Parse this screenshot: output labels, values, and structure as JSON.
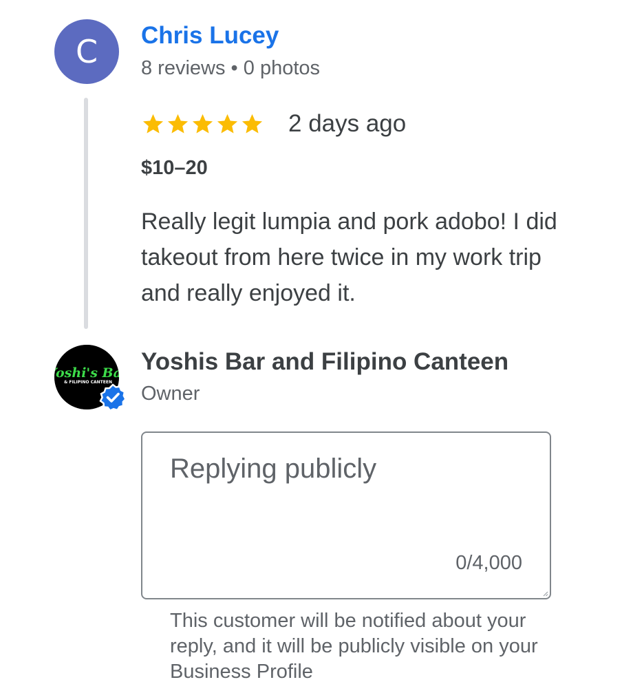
{
  "review": {
    "avatar_letter": "C",
    "avatar_color": "#5c6bc0",
    "reviewer_name": "Chris Lucey",
    "reviewer_stats": "8 reviews • 0 photos",
    "rating": 5,
    "rating_max": 5,
    "star_color": "#fbbc04",
    "date": "2 days ago",
    "price_range": "$10–20",
    "text": "Really legit lumpia and pork adobo! I did takeout from here twice in my work trip and really enjoyed it."
  },
  "owner": {
    "name": "Yoshis Bar and Filipino Canteen",
    "role": "Owner",
    "logo_text_main": "Yoshi's Bar",
    "logo_text_sub": "& FILIPINO CANTEEN",
    "logo_color": "#3ddc4a",
    "badge_icon": "verified-check-icon",
    "badge_color": "#1a73e8"
  },
  "reply": {
    "placeholder": "Replying publicly",
    "value": "",
    "counter": "0/4,000",
    "notice": "This customer will be notified about your reply, and it will be publicly visible on your Business Profile"
  },
  "colors": {
    "name_link": "#1a73e8",
    "primary_text": "#3c4043",
    "secondary_text": "#5f6368",
    "thread_line": "#dadce0",
    "input_border": "#80868b"
  }
}
